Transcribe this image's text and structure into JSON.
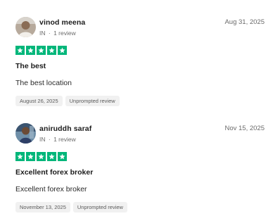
{
  "reviews": [
    {
      "reviewer": "vinod meena",
      "country": "IN",
      "review_count": "1 review",
      "date": "Aug 31, 2025",
      "rating": 5,
      "title": "The best",
      "text": "The best location",
      "experience_date": "August 26, 2025",
      "tag": "Unprompted review",
      "colors": {
        "star_fill": "#00b67a"
      }
    },
    {
      "reviewer": "aniruddh saraf",
      "country": "IN",
      "review_count": "1 review",
      "date": "Nov 15, 2025",
      "rating": 5,
      "title": "Excellent forex broker",
      "text": "Excellent forex broker",
      "experience_date": "November 13, 2025",
      "tag": "Unprompted review",
      "colors": {
        "star_fill": "#00b67a"
      }
    }
  ],
  "separator": "·"
}
